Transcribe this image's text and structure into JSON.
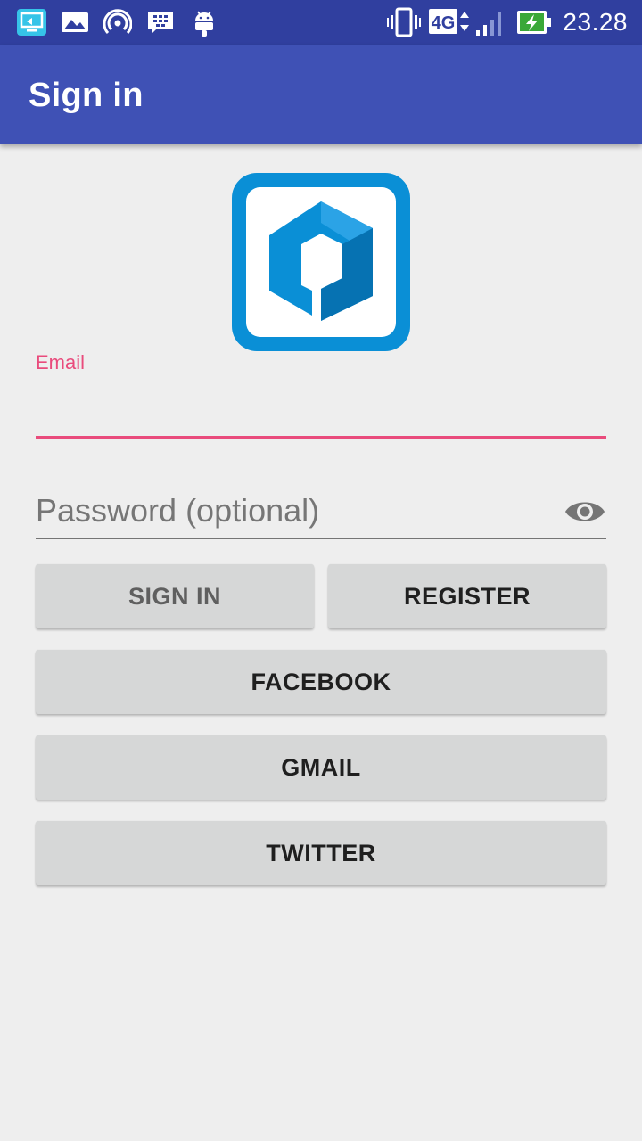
{
  "status_bar": {
    "time": "23.28",
    "network": "4G",
    "icons": [
      "screen-share-icon",
      "gallery-icon",
      "hotspot-icon",
      "bbm-icon",
      "android-icon",
      "vibrate-icon",
      "network-4g-icon",
      "signal-icon",
      "battery-charging-icon"
    ]
  },
  "app_bar": {
    "title": "Sign in",
    "color": "#3f51b5"
  },
  "logo": {
    "icon": "app-logo-cube-icon",
    "color": "#0a8fd6"
  },
  "form": {
    "email_label": "Email",
    "email_value": "",
    "password_placeholder": "Password (optional)",
    "password_value": "",
    "accent_color": "#e94b7c"
  },
  "buttons": {
    "sign_in": "SIGN IN",
    "register": "REGISTER",
    "facebook": "FACEBOOK",
    "gmail": "GMAIL",
    "twitter": "TWITTER"
  }
}
